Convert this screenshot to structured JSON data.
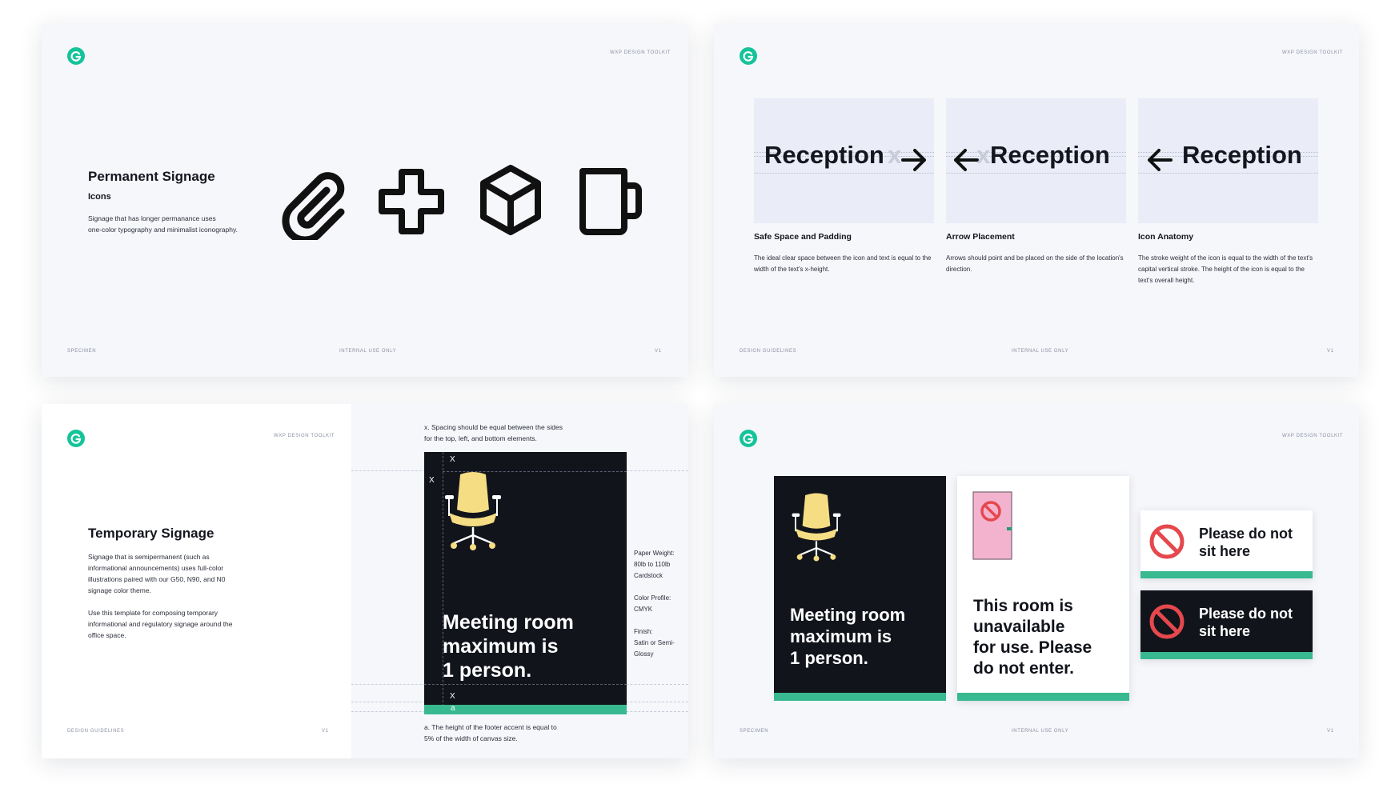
{
  "toolkit_label": "WXP DESIGN TOOLKIT",
  "colors": {
    "brand": "#15c39a",
    "accent": "#38b98f",
    "dark": "#12141c",
    "chair": "#f5dd84",
    "door": "#f3b3cf",
    "prohibit": "#e5484d"
  },
  "slide1": {
    "title": "Permanent Signage",
    "subtitle": "Icons",
    "body_1": "Signage that has longer permanance uses",
    "body_2": "one-color typography and minimalist iconography.",
    "icons": [
      "paperclip-icon",
      "plus-icon",
      "cube-icon",
      "mug-icon"
    ],
    "footer_left": "SPECIMEN",
    "footer_center": "INTERNAL USE ONLY",
    "footer_right": "V1"
  },
  "slide2": {
    "cards": [
      {
        "word": "Reception",
        "title": "Safe Space and Padding",
        "desc": "The ideal clear space between the icon and text is equal to the width of the text's x-height."
      },
      {
        "word": "Reception",
        "title": "Arrow Placement",
        "desc": "Arrows should point and be placed on the side of the location's direction."
      },
      {
        "word": "Reception",
        "title": "Icon Anatomy",
        "desc": "The stroke weight of the icon is equal to the width of the text's capital vertical stroke. The height of the icon is equal to the text's overall height."
      }
    ],
    "x_marker": "x",
    "footer_left": "DESIGN GUIDELINES",
    "footer_center": "INTERNAL USE ONLY",
    "footer_right": "V1"
  },
  "slide3": {
    "title": "Temporary Signage",
    "body_1a": "Signage that is semipermanent (such as",
    "body_1b": "informational announcements) uses full-color",
    "body_1c": "illustrations paired with our G50, N90, and N0",
    "body_1d": "signage color theme.",
    "body_2a": "Use this template for composing temporary",
    "body_2b": "informational and regulatory signage around the",
    "body_2c": "office space.",
    "note_top_1": "x. Spacing should be equal between the sides",
    "note_top_2": "for the top, left, and bottom elements.",
    "sign_line_1": "Meeting room",
    "sign_line_2": "maximum is",
    "sign_line_3": "1 person.",
    "marker_x": "X",
    "marker_a": "a",
    "spec_paper_label": "Paper Weight:",
    "spec_paper_1": "80lb to 110lb",
    "spec_paper_2": "Cardstock",
    "spec_color_label": "Color Profile:",
    "spec_color_value": "CMYK",
    "spec_finish_label": "Finish:",
    "spec_finish_1": "Satin or Semi-",
    "spec_finish_2": "Glossy",
    "note_bottom_1": "a. The height of the footer accent is equal to",
    "note_bottom_2": "5% of the width of canvas size.",
    "footer_left": "DESIGN GUIDELINES",
    "footer_right": "V1"
  },
  "slide4": {
    "sign1_line_1": "Meeting room",
    "sign1_line_2": "maximum is",
    "sign1_line_3": "1 person.",
    "sign2_line_1": "This room is",
    "sign2_line_2": "unavailable",
    "sign2_line_3": "for use. Please",
    "sign2_line_4": "do not enter.",
    "sign3_line_1": "Please do not",
    "sign3_line_2": "sit here",
    "sign4_line_1": "Please do not",
    "sign4_line_2": "sit here",
    "footer_left": "SPECIMEN",
    "footer_center": "INTERNAL USE ONLY",
    "footer_right": "V1"
  }
}
